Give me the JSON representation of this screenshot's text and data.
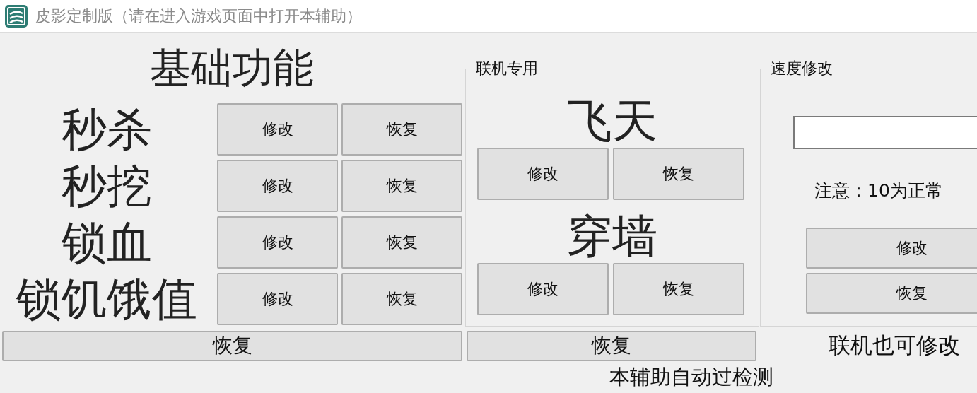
{
  "window": {
    "title": "皮影定制版（请在进入游戏页面中打开本辅助）"
  },
  "basic": {
    "heading": "基础功能",
    "rows": [
      {
        "label": "秒杀",
        "buttons": [
          "修改",
          "恢复"
        ]
      },
      {
        "label": "秒挖",
        "buttons": [
          "修改",
          "恢复"
        ]
      },
      {
        "label": "锁血",
        "buttons": [
          "修改",
          "恢复"
        ]
      },
      {
        "label": "锁饥饿值",
        "buttons": [
          "修改",
          "恢复"
        ]
      }
    ]
  },
  "online": {
    "legend": "联机专用",
    "features": [
      {
        "label": "飞天",
        "buttons": [
          "修改",
          "恢复"
        ]
      },
      {
        "label": "穿墙",
        "buttons": [
          "修改",
          "恢复"
        ]
      }
    ]
  },
  "speed": {
    "legend": "速度修改",
    "note": "注意：10为正常",
    "buttons": [
      "修改",
      "恢复"
    ]
  },
  "bottom": {
    "buttons": [
      "恢复",
      "恢复"
    ],
    "note": "联机也可修改"
  },
  "footer": "本辅助自动过检测"
}
